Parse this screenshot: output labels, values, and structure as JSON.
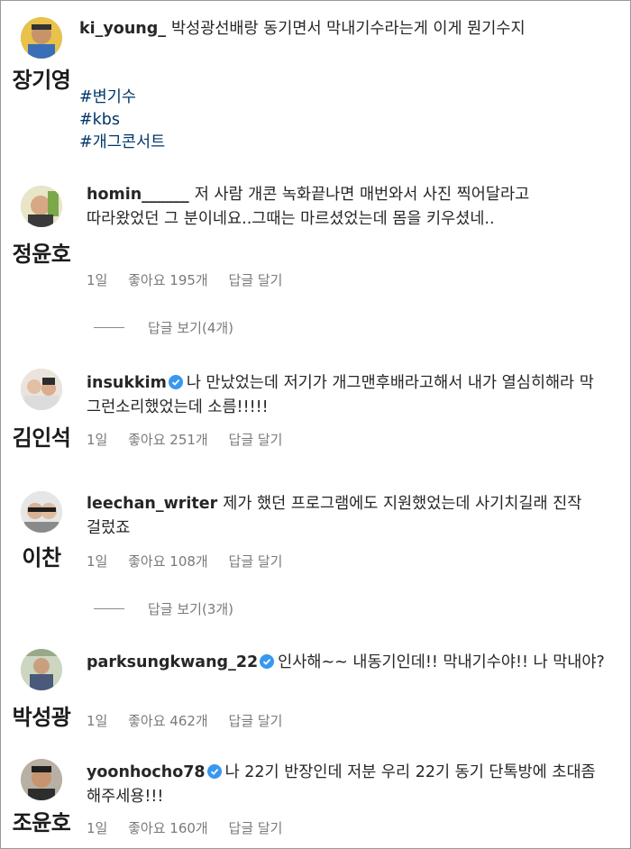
{
  "comments": [
    {
      "caption": "장기영",
      "username": "ki_young_",
      "verified": false,
      "text": "박성광선배랑 동기면서 막내기수라는게 이게 뭔기수지",
      "hashtags": [
        "#변기수",
        "#kbs",
        "#개그콘서트"
      ]
    },
    {
      "caption": "정윤호",
      "username": "homin______",
      "verified": false,
      "text": "저 사람 개콘 녹화끝나면 매번와서 사진 찍어달라고 따라왔었던 그 분이네요..그때는 마르셨었는데 몸을 키우셨네..",
      "time": "1일",
      "likes": "좋아요 195개",
      "reply": "답글 달기",
      "view_replies": "답글 보기(4개)"
    },
    {
      "caption": "김인석",
      "username": "insukkim",
      "verified": true,
      "text": "나 만났었는데 저기가 개그맨후배라고해서 내가 열심히해라 막 그런소리했었는데 소름!!!!!",
      "time": "1일",
      "likes": "좋아요 251개",
      "reply": "답글 달기"
    },
    {
      "caption": "이찬",
      "username": "leechan_writer",
      "verified": false,
      "text": "제가 했던 프로그램에도 지원했었는데 사기치길래 진작 걸렀죠",
      "time": "1일",
      "likes": "좋아요 108개",
      "reply": "답글 달기",
      "view_replies": "답글 보기(3개)"
    },
    {
      "caption": "박성광",
      "username": "parksungkwang_22",
      "verified": true,
      "text": "인사해~~ 내동기인데!! 막내기수야!! 나 막내야?",
      "time": "1일",
      "likes": "좋아요 462개",
      "reply": "답글 달기"
    },
    {
      "caption": "조윤호",
      "username": "yoonhocho78",
      "verified": true,
      "text": "나 22기 반장인데 저분 우리 22기 동기 단톡방에 초대좀 해주세용!!!",
      "time": "1일",
      "likes": "좋아요 160개",
      "reply": "답글 달기"
    }
  ],
  "colors": {
    "text": "#262626",
    "meta": "#7a7a7a",
    "hashtag": "#00376b",
    "verified": "#3897f0"
  }
}
